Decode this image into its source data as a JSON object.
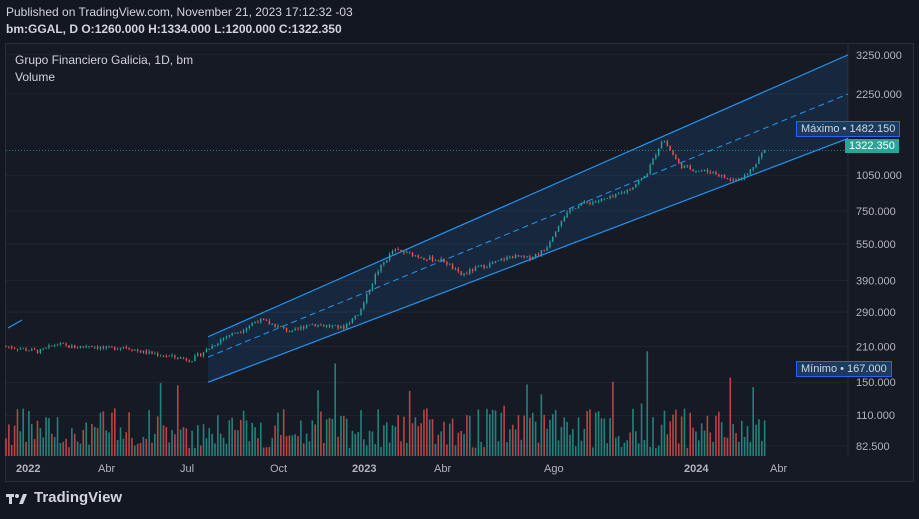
{
  "header": {
    "published": "Published on TradingView.com, November 21, 2023 17:12:32 -03",
    "symbol": "bm:GGAL, D",
    "ohlc": {
      "o_label": "O:",
      "o": "1260.000",
      "h_label": "H:",
      "h": "1334.000",
      "l_label": "L:",
      "l": "1200.000",
      "c_label": "C:",
      "c": "1322.350"
    }
  },
  "legend": {
    "title": "Grupo Financiero Galicia, 1D, bm",
    "volume": "Volume"
  },
  "tags": {
    "max": "Máximo • 1482.150",
    "min": "Mínimo • 167.000",
    "last": "1322.350"
  },
  "footer": {
    "brand": "TradingView"
  },
  "colors": {
    "up": "#26a69a",
    "down": "#ef5350",
    "channel": "#2196f3",
    "background": "#131722",
    "grid": "#2a2e39"
  },
  "chart_data": {
    "type": "candlestick",
    "y_scale": "log",
    "y_ticks": [
      "3250.000",
      "2250.000",
      "1482.150",
      "1322.350",
      "1050.000",
      "750.000",
      "550.000",
      "390.000",
      "290.000",
      "210.000",
      "167.000",
      "150.000",
      "110.000",
      "82.500"
    ],
    "y_tick_values": [
      3250,
      2250,
      1050,
      750,
      550,
      390,
      290,
      210,
      150,
      110,
      82.5
    ],
    "x_ticks": [
      "2022",
      "Abr",
      "Jul",
      "Oct",
      "2023",
      "Abr",
      "Ago",
      "2024",
      "Abr"
    ],
    "last_price": 1322.35,
    "max": 1482.15,
    "min": 167.0,
    "series": [
      {
        "name": "price",
        "points": [
          [
            0,
            210
          ],
          [
            10,
            205
          ],
          [
            20,
            200
          ],
          [
            30,
            215
          ],
          [
            40,
            208
          ],
          [
            50,
            212
          ],
          [
            60,
            205
          ],
          [
            70,
            210
          ],
          [
            80,
            200
          ],
          [
            90,
            195
          ],
          [
            100,
            190
          ],
          [
            110,
            185
          ],
          [
            120,
            205
          ],
          [
            130,
            230
          ],
          [
            140,
            245
          ],
          [
            150,
            270
          ],
          [
            160,
            255
          ],
          [
            170,
            240
          ],
          [
            180,
            260
          ],
          [
            190,
            255
          ],
          [
            200,
            250
          ],
          [
            210,
            290
          ],
          [
            220,
            420
          ],
          [
            230,
            520
          ],
          [
            240,
            500
          ],
          [
            250,
            480
          ],
          [
            260,
            470
          ],
          [
            270,
            410
          ],
          [
            280,
            440
          ],
          [
            290,
            460
          ],
          [
            300,
            490
          ],
          [
            310,
            480
          ],
          [
            320,
            520
          ],
          [
            330,
            700
          ],
          [
            340,
            800
          ],
          [
            350,
            820
          ],
          [
            360,
            850
          ],
          [
            370,
            920
          ],
          [
            380,
            1050
          ],
          [
            390,
            1482
          ],
          [
            400,
            1150
          ],
          [
            410,
            1100
          ],
          [
            420,
            1080
          ],
          [
            430,
            1000
          ],
          [
            440,
            1050
          ],
          [
            450,
            1322
          ]
        ]
      }
    ],
    "channel": {
      "upper": [
        [
          120,
          230
        ],
        [
          500,
          3250
        ]
      ],
      "mid": [
        [
          120,
          190
        ],
        [
          500,
          2250
        ]
      ],
      "lower": [
        [
          120,
          150
        ],
        [
          500,
          1482
        ]
      ]
    }
  }
}
